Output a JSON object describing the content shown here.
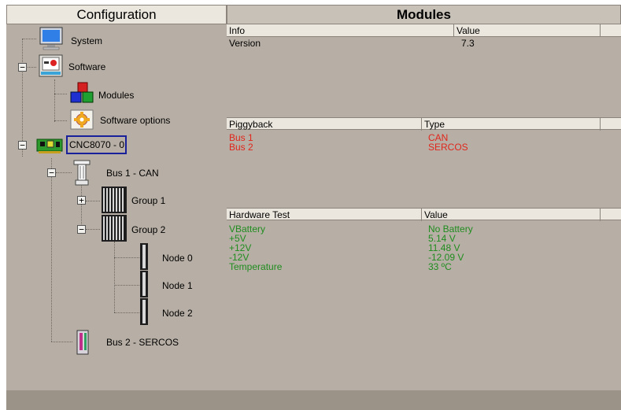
{
  "config": {
    "title": "Configuration",
    "tree": {
      "system": "System",
      "software": "Software",
      "modules": "Modules",
      "software_options": "Software options",
      "cnc": "CNC8070 - 0",
      "bus1": "Bus 1 - CAN",
      "group1": "Group 1",
      "group2": "Group 2",
      "node0": "Node 0",
      "node1": "Node 1",
      "node2": "Node 2",
      "bus2": "Bus 2 - SERCOS"
    },
    "expanders": {
      "minus": "−",
      "plus": "+"
    }
  },
  "modules": {
    "title": "Modules",
    "info_table": {
      "headers": [
        "Info",
        "Value"
      ],
      "rows": [
        {
          "name": "Version",
          "value": "7.3"
        }
      ]
    },
    "piggyback_table": {
      "headers": [
        "Piggyback",
        "Type"
      ],
      "rows": [
        {
          "name": "Bus 1",
          "value": "CAN"
        },
        {
          "name": "Bus 2",
          "value": "SERCOS"
        }
      ],
      "text_color": "#e0261c"
    },
    "hardware_table": {
      "headers": [
        "Hardware Test",
        "Value"
      ],
      "rows": [
        {
          "name": "VBattery",
          "value": "No Battery"
        },
        {
          "name": "+5V",
          "value": "5.14 V"
        },
        {
          "name": "+12V",
          "value": "11.48 V"
        },
        {
          "name": "-12V",
          "value": "-12.09 V"
        },
        {
          "name": "Temperature",
          "value": "33 ºC"
        }
      ],
      "text_color": "#1f8c1f"
    }
  },
  "icons": {
    "system": "monitor-icon",
    "software": "software-box-icon",
    "modules": "modules-cubes-icon",
    "software_options": "options-gear-icon",
    "cnc": "circuit-board-icon",
    "bus1": "can-bus-connector-icon",
    "group": "rack-group-icon",
    "node": "node-module-icon",
    "bus2": "sercos-bus-icon"
  }
}
